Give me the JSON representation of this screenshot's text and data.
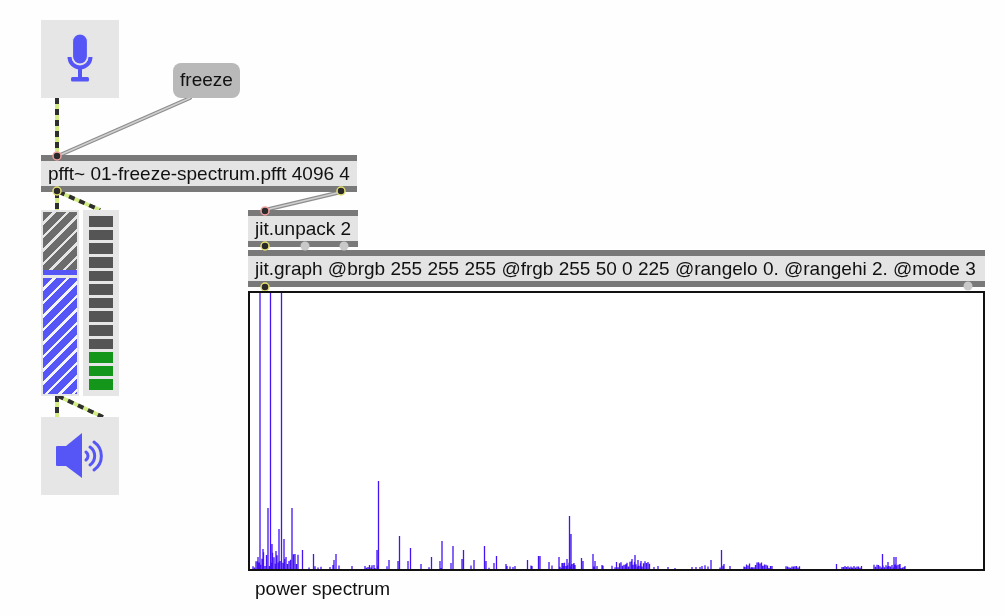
{
  "patcher": {
    "message_box": {
      "text": "freeze"
    },
    "objects": [
      {
        "text": "pfft~ 01-freeze-spectrum.pfft 4096 4"
      },
      {
        "text": "jit.unpack 2"
      },
      {
        "text": "jit.graph @brgb 255 255 255 @frgb 255 50 0 225 @rangelo 0. @rangehi 2. @mode 3"
      }
    ],
    "gain_slider": {
      "level": 0.68
    },
    "meter": {
      "level": 0.23
    },
    "comment": "power spectrum"
  }
}
